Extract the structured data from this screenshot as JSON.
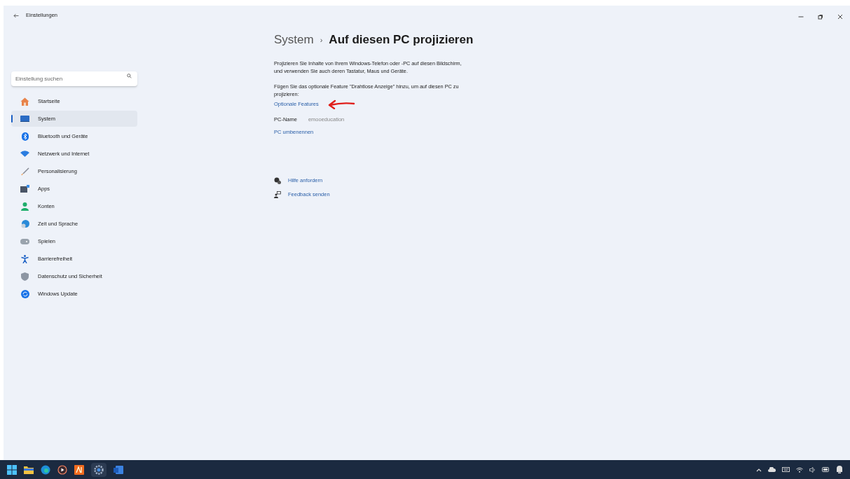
{
  "window": {
    "title": "Einstellungen"
  },
  "search": {
    "placeholder": "Einstellung suchen"
  },
  "nav": [
    {
      "label": "Startseite",
      "selected": false
    },
    {
      "label": "System",
      "selected": true
    },
    {
      "label": "Bluetooth und Geräte",
      "selected": false
    },
    {
      "label": "Netzwerk und Internet",
      "selected": false
    },
    {
      "label": "Personalisierung",
      "selected": false
    },
    {
      "label": "Apps",
      "selected": false
    },
    {
      "label": "Konten",
      "selected": false
    },
    {
      "label": "Zeit und Sprache",
      "selected": false
    },
    {
      "label": "Spielen",
      "selected": false
    },
    {
      "label": "Barrierefreiheit",
      "selected": false
    },
    {
      "label": "Datenschutz und Sicherheit",
      "selected": false
    },
    {
      "label": "Windows Update",
      "selected": false
    }
  ],
  "breadcrumb": {
    "parent": "System",
    "separator": "›",
    "current": "Auf diesen PC projizieren"
  },
  "description": "Projizieren Sie Inhalte von Ihrem Windows-Telefon oder -PC auf diesen Bildschirm, und verwenden Sie auch deren Tastatur, Maus und Geräte.",
  "feature_note": "Fügen Sie das optionale Feature \"Drahtlose Anzeige\" hinzu, um auf diesen PC zu projizieren:",
  "feature_link": "Optionale Features",
  "pc_name": {
    "label": "PC-Name",
    "value": "emooeducation"
  },
  "rename_link": "PC umbenennen",
  "help_links": [
    "Hilfe anfordern",
    "Feedback senden"
  ]
}
